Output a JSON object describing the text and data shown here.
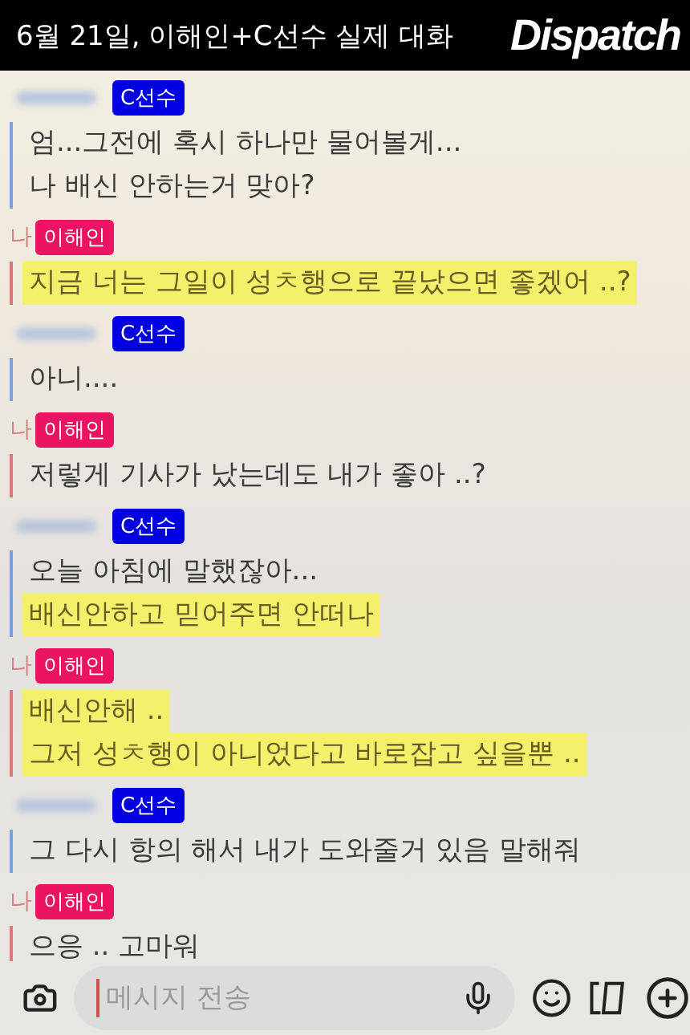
{
  "header": {
    "title": "6월 21일, 이해인+C선수 실제 대화",
    "logo": "Dispatch"
  },
  "messages": [
    {
      "kind": "other",
      "label": "C선수",
      "lines": [
        {
          "text": "엄...그전에 혹시 하나만 물어볼게...",
          "highlighted": false
        },
        {
          "text": "나 배신 안하는거 맞아?",
          "highlighted": false
        }
      ]
    },
    {
      "kind": "me",
      "me_mark": "나",
      "label": "이해인",
      "lines": [
        {
          "text": "지금 너는 그일이 성ㅊ행으로 끝났으면 좋겠어 ..?",
          "highlighted": true
        }
      ]
    },
    {
      "kind": "other",
      "label": "C선수",
      "lines": [
        {
          "text": "아니....",
          "highlighted": false
        }
      ]
    },
    {
      "kind": "me",
      "me_mark": "나",
      "label": "이해인",
      "lines": [
        {
          "text": "저렇게 기사가 났는데도 내가 좋아 ..?",
          "highlighted": false
        }
      ]
    },
    {
      "kind": "other",
      "label": "C선수",
      "lines": [
        {
          "text": "오늘 아침에 말했잖아...",
          "highlighted": false
        },
        {
          "text": "배신안하고 믿어주면 안떠나",
          "highlighted": true
        }
      ]
    },
    {
      "kind": "me",
      "me_mark": "나",
      "label": "이해인",
      "lines": [
        {
          "text": "배신안해 ..",
          "highlighted": true
        },
        {
          "text": "그저 성ㅊ행이 아니었다고 바로잡고 싶을뿐 ..",
          "highlighted": true
        }
      ]
    },
    {
      "kind": "other",
      "label": "C선수",
      "lines": [
        {
          "text": "그 다시 항의 해서 내가 도와줄거 있음 말해줘",
          "highlighted": false
        }
      ]
    },
    {
      "kind": "me",
      "me_mark": "나",
      "label": "이해인",
      "lines": [
        {
          "text": "으응 .. 고마워",
          "highlighted": false
        }
      ]
    }
  ],
  "input": {
    "placeholder": "메시지 전송"
  }
}
